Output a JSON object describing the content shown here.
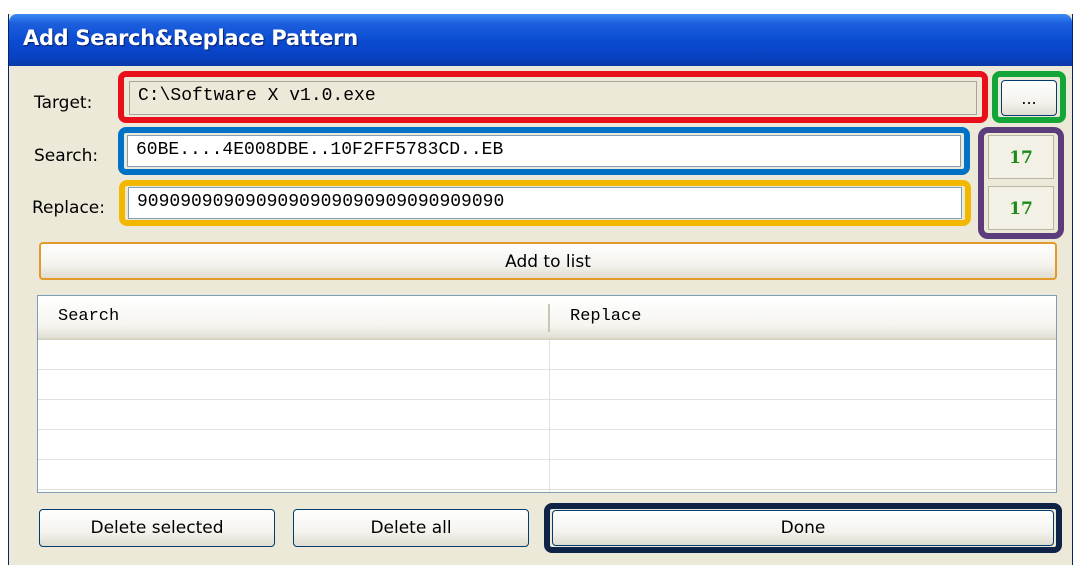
{
  "window": {
    "title": "Add Search&Replace Pattern"
  },
  "target": {
    "label": "Target:",
    "value": "C:\\Software X v1.0.exe",
    "browse_label": "..."
  },
  "search": {
    "label": "Search:",
    "value": "60BE....4E008DBE..10F2FF5783CD..EB",
    "count": "17"
  },
  "replace": {
    "label": "Replace:",
    "value": "9090909090909090909090909090909090",
    "count": "17"
  },
  "add_button": "Add to list",
  "list": {
    "columns": [
      "Search",
      "Replace"
    ],
    "rows": []
  },
  "buttons": {
    "delete_selected": "Delete selected",
    "delete_all": "Delete all",
    "done": "Done"
  },
  "colors": {
    "title_bar": "#0a4ad0",
    "window_bg": "#ece9d8",
    "counter_text": "#1b8a1b",
    "highlight_red": "#e8101a",
    "highlight_blue": "#0072c6",
    "highlight_yellow": "#f2b800",
    "highlight_green": "#13a538",
    "highlight_purple": "#5a3d7a",
    "highlight_navy": "#0e2345"
  }
}
